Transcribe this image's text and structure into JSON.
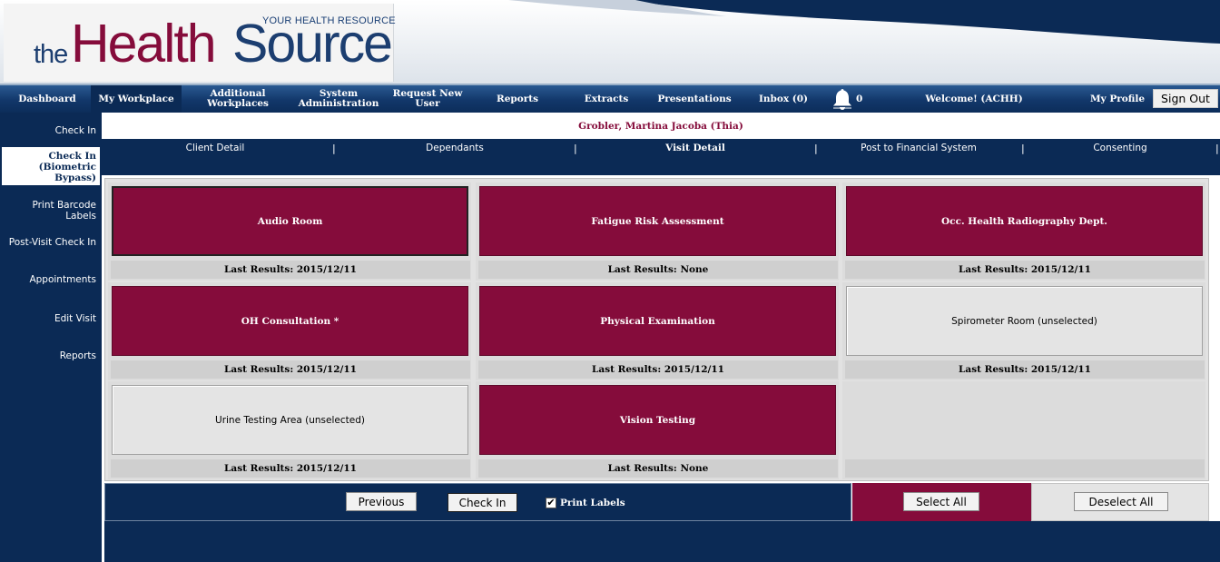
{
  "header": {
    "logo_the": "the",
    "logo_health": "Health",
    "logo_source": "Source",
    "logo_tagline": "YOUR HEALTH RESOURCE"
  },
  "nav": {
    "items": [
      {
        "label": "Dashboard"
      },
      {
        "label": "My Workplace"
      },
      {
        "label": "Additional Workplaces"
      },
      {
        "label": "System Administration"
      },
      {
        "label": "Request New User"
      },
      {
        "label": "Reports"
      },
      {
        "label": "Extracts"
      },
      {
        "label": "Presentations"
      },
      {
        "label": "Inbox (0)"
      },
      {
        "label": "Welcome! (ACHH)"
      },
      {
        "label": "My Profile"
      }
    ],
    "active": "My Workplace",
    "notification_count": "0",
    "sign_out": "Sign Out"
  },
  "sidebar": {
    "items": [
      {
        "label": "Check In"
      },
      {
        "label": "Check In (Biometric Bypass)"
      },
      {
        "label": "Print Barcode Labels"
      },
      {
        "label": "Post-Visit Check In"
      },
      {
        "label": "Appointments"
      },
      {
        "label": "Edit Visit"
      },
      {
        "label": "Reports"
      }
    ],
    "active": "Check In (Biometric Bypass)"
  },
  "patient": {
    "name": "Grobler, Martina Jacoba (Thia)"
  },
  "subnav": {
    "items": [
      {
        "label": "Client Detail"
      },
      {
        "label": "Dependants"
      },
      {
        "label": "Visit Detail"
      },
      {
        "label": "Post to Financial System"
      },
      {
        "label": "Consenting"
      }
    ],
    "separator": "|",
    "active": "Visit Detail"
  },
  "rooms": [
    {
      "name": "Audio Room",
      "selected": true,
      "results": "Last Results: 2015/12/11"
    },
    {
      "name": "Fatigue Risk Assessment",
      "selected": true,
      "results": "Last Results: None"
    },
    {
      "name": "Occ. Health Radiography Dept.",
      "selected": true,
      "results": "Last Results: 2015/12/11"
    },
    {
      "name": "OH Consultation *",
      "selected": true,
      "results": "Last Results: 2015/12/11"
    },
    {
      "name": "Physical Examination",
      "selected": true,
      "results": "Last Results: 2015/12/11"
    },
    {
      "name": "Spirometer Room (unselected)",
      "selected": false,
      "results": "Last Results: 2015/12/11"
    },
    {
      "name": "Urine Testing Area (unselected)",
      "selected": false,
      "results": "Last Results: 2015/12/11"
    },
    {
      "name": "Vision Testing",
      "selected": true,
      "results": "Last Results: None"
    }
  ],
  "actions": {
    "previous": "Previous",
    "check_in": "Check In",
    "print_labels": "Print Labels",
    "print_labels_checked": true,
    "select_all": "Select All",
    "deselect_all": "Deselect All"
  },
  "colors": {
    "navy": "#0b2a55",
    "maroon": "#850c3b",
    "panel_grey": "#dcdcdc"
  }
}
